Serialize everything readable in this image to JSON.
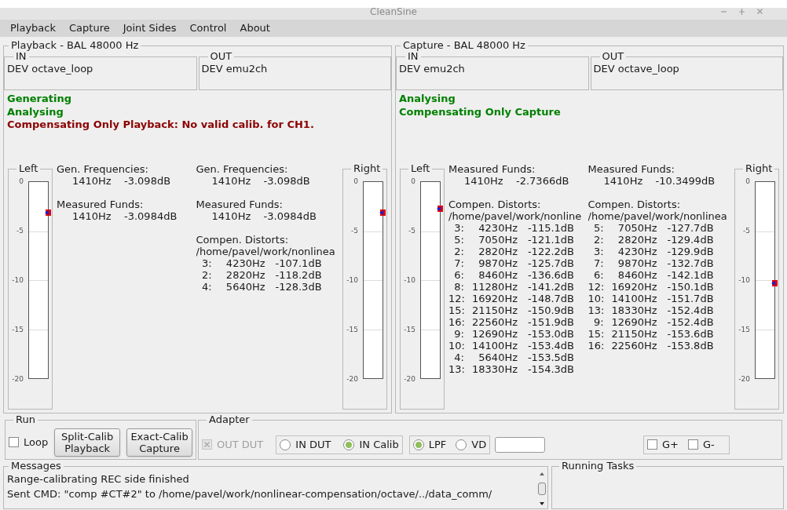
{
  "window": {
    "title": "CleanSine"
  },
  "menu": [
    "Playback",
    "Capture",
    "Joint Sides",
    "Control",
    "About"
  ],
  "sides": [
    {
      "title": "Playback - BAL  48000 Hz",
      "in": {
        "label": "IN",
        "device": "DEV octave_loop"
      },
      "out": {
        "label": "OUT",
        "device": "DEV emu2ch"
      },
      "status": [
        {
          "text": "Generating",
          "color": "#008000"
        },
        {
          "text": "Analysing",
          "color": "#008000"
        },
        {
          "text": "Compensating Only Playback:  No valid calib. for CH1.",
          "color": "#8b0000"
        }
      ],
      "left_meter": {
        "label": "Left",
        "scale": [
          "0",
          "-5",
          "-10",
          "-15",
          "-20"
        ],
        "level": 0.845
      },
      "columns": [
        [
          {
            "kind": "funds",
            "title": "Gen. Frequencies:",
            "rows": [
              {
                "freq": "1410Hz",
                "db": "-3.098dB"
              }
            ]
          },
          {
            "kind": "funds",
            "title": "Measured Funds:",
            "rows": [
              {
                "freq": "1410Hz",
                "db": "-3.0984dB"
              }
            ]
          }
        ],
        [
          {
            "kind": "funds",
            "title": "Gen. Frequencies:",
            "rows": [
              {
                "freq": "1410Hz",
                "db": "-3.098dB"
              }
            ]
          },
          {
            "kind": "funds",
            "title": "Measured Funds:",
            "rows": [
              {
                "freq": "1410Hz",
                "db": "-3.0984dB"
              }
            ]
          },
          {
            "kind": "distorts",
            "title": "Compen. Distorts:",
            "path": "/home/pavel/work/nonlinea",
            "rows": [
              {
                "harmonic": "3:",
                "freq": "4230Hz",
                "db": "-107.1dB"
              },
              {
                "harmonic": "2:",
                "freq": "2820Hz",
                "db": "-118.2dB"
              },
              {
                "harmonic": "4:",
                "freq": "5640Hz",
                "db": "-128.3dB"
              }
            ]
          }
        ]
      ],
      "right_meter": {
        "label": "Right",
        "scale": [
          "0",
          "-5",
          "-10",
          "-15",
          "-20"
        ],
        "level": 0.845
      }
    },
    {
      "title": "Capture - BAL  48000 Hz",
      "in": {
        "label": "IN",
        "device": "DEV emu2ch"
      },
      "out": {
        "label": "OUT",
        "device": "DEV octave_loop"
      },
      "status": [
        {
          "text": "Analysing",
          "color": "#008000"
        },
        {
          "text": "Compensating Only Capture",
          "color": "#008000"
        }
      ],
      "left_meter": {
        "label": "Left",
        "scale": [
          "0",
          "-5",
          "-10",
          "-15",
          "-20"
        ],
        "level": 0.863
      },
      "columns": [
        [
          {
            "kind": "funds",
            "title": "Measured Funds:",
            "rows": [
              {
                "freq": "1410Hz",
                "db": "-2.7366dB"
              }
            ]
          },
          {
            "kind": "distorts",
            "title": "Compen. Distorts:",
            "path": "/home/pavel/work/nonline",
            "rows": [
              {
                "harmonic": "3:",
                "freq": "4230Hz",
                "db": "-115.1dB"
              },
              {
                "harmonic": "5:",
                "freq": "7050Hz",
                "db": "-121.1dB"
              },
              {
                "harmonic": "2:",
                "freq": "2820Hz",
                "db": "-122.2dB"
              },
              {
                "harmonic": "7:",
                "freq": "9870Hz",
                "db": "-125.7dB"
              },
              {
                "harmonic": "6:",
                "freq": "8460Hz",
                "db": "-136.6dB"
              },
              {
                "harmonic": "8:",
                "freq": "11280Hz",
                "db": "-141.2dB"
              },
              {
                "harmonic": "12:",
                "freq": "16920Hz",
                "db": "-148.7dB"
              },
              {
                "harmonic": "15:",
                "freq": "21150Hz",
                "db": "-150.9dB"
              },
              {
                "harmonic": "16:",
                "freq": "22560Hz",
                "db": "-151.9dB"
              },
              {
                "harmonic": "9:",
                "freq": "12690Hz",
                "db": "-153.0dB"
              },
              {
                "harmonic": "10:",
                "freq": "14100Hz",
                "db": "-153.4dB"
              },
              {
                "harmonic": "4:",
                "freq": "5640Hz",
                "db": "-153.5dB"
              },
              {
                "harmonic": "13:",
                "freq": "18330Hz",
                "db": "-154.3dB"
              }
            ]
          }
        ],
        [
          {
            "kind": "funds",
            "title": "Measured Funds:",
            "rows": [
              {
                "freq": "1410Hz",
                "db": "-10.3499dB"
              }
            ]
          },
          {
            "kind": "distorts",
            "title": "Compen. Distorts:",
            "path": "/home/pavel/work/nonlinea",
            "rows": [
              {
                "harmonic": "5:",
                "freq": "7050Hz",
                "db": "-127.7dB"
              },
              {
                "harmonic": "2:",
                "freq": "2820Hz",
                "db": "-129.4dB"
              },
              {
                "harmonic": "3:",
                "freq": "4230Hz",
                "db": "-129.9dB"
              },
              {
                "harmonic": "7:",
                "freq": "9870Hz",
                "db": "-132.7dB"
              },
              {
                "harmonic": "6:",
                "freq": "8460Hz",
                "db": "-142.1dB"
              },
              {
                "harmonic": "12:",
                "freq": "16920Hz",
                "db": "-150.1dB"
              },
              {
                "harmonic": "10:",
                "freq": "14100Hz",
                "db": "-151.7dB"
              },
              {
                "harmonic": "13:",
                "freq": "18330Hz",
                "db": "-152.4dB"
              },
              {
                "harmonic": "9:",
                "freq": "12690Hz",
                "db": "-152.4dB"
              },
              {
                "harmonic": "15:",
                "freq": "21150Hz",
                "db": "-153.6dB"
              },
              {
                "harmonic": "16:",
                "freq": "22560Hz",
                "db": "-153.8dB"
              }
            ]
          }
        ]
      ],
      "right_meter": {
        "label": "Right",
        "scale": [
          "0",
          "-5",
          "-10",
          "-15",
          "-20"
        ],
        "level": 0.483
      }
    }
  ],
  "run": {
    "title": "Run",
    "loop": {
      "label": "Loop",
      "checked": false
    },
    "buttons": [
      "Split-Calib Playback",
      "Exact-Calib Capture"
    ]
  },
  "adapter": {
    "title": "Adapter",
    "out_dut": {
      "label": "OUT DUT",
      "checked": true,
      "disabled": true
    },
    "input_mode": [
      {
        "label": "IN DUT",
        "selected": false
      },
      {
        "label": "IN Calib",
        "selected": true
      }
    ],
    "filter": [
      {
        "label": "LPF",
        "selected": true
      },
      {
        "label": "VD",
        "selected": false
      }
    ],
    "gain": [
      {
        "label": "G+",
        "checked": false
      },
      {
        "label": "G-",
        "checked": false
      }
    ]
  },
  "messages": {
    "title": "Messages",
    "lines": [
      "Range-calibrating REC side finished",
      "Sent CMD: \"comp #CT#2\" to /home/pavel/work/nonlinear-compensation/octave/../data_comm/"
    ]
  },
  "running_tasks": {
    "title": "Running Tasks"
  }
}
